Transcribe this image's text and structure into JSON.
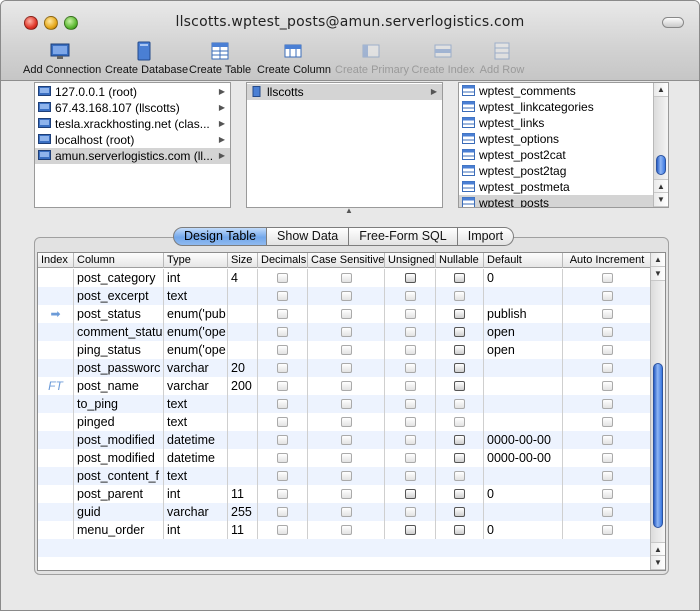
{
  "window": {
    "title": "llscotts.wptest_posts@amun.serverlogistics.com"
  },
  "toolbar": {
    "add_connection": "Add Connection",
    "create_database": "Create Database",
    "create_table": "Create Table",
    "create_column": "Create Column",
    "create_primary": "Create Primary",
    "create_index": "Create Index",
    "add_row": "Add Row"
  },
  "hosts": [
    "127.0.0.1 (root)",
    "67.43.168.107 (llscotts)",
    "tesla.xrackhosting.net (clas...",
    "localhost (root)",
    "amun.serverlogistics.com (ll..."
  ],
  "databases": [
    "llscotts"
  ],
  "tables": [
    "wptest_comments",
    "wptest_linkcategories",
    "wptest_links",
    "wptest_options",
    "wptest_post2cat",
    "wptest_post2tag",
    "wptest_postmeta",
    "wptest_posts"
  ],
  "tabs": {
    "design_table": "Design Table",
    "show_data": "Show Data",
    "free_form_sql": "Free-Form SQL",
    "import": "Import"
  },
  "grid": {
    "headers": {
      "index": "Index",
      "column": "Column",
      "type": "Type",
      "size": "Size",
      "decimals": "Decimals",
      "case_sensitive": "Case Sensitive",
      "unsigned": "Unsigned",
      "nullable": "Nullable",
      "default": "Default",
      "auto_increment": "Auto Increment"
    },
    "rows": [
      {
        "index": "",
        "column": "post_category",
        "type": "int",
        "size": "4",
        "default": "0",
        "unsigned": "dark",
        "nullable": "dark"
      },
      {
        "index": "",
        "column": "post_excerpt",
        "type": "text",
        "size": "",
        "default": "",
        "unsigned": "light",
        "nullable": "light"
      },
      {
        "index": "➡",
        "column": "post_status",
        "type": "enum('pub",
        "size": "",
        "default": "publish",
        "unsigned": "light",
        "nullable": "dark"
      },
      {
        "index": "",
        "column": "comment_statu",
        "type": "enum('ope",
        "size": "",
        "default": "open",
        "unsigned": "light",
        "nullable": "dark"
      },
      {
        "index": "",
        "column": "ping_status",
        "type": "enum('ope",
        "size": "",
        "default": "open",
        "unsigned": "light",
        "nullable": "dark"
      },
      {
        "index": "",
        "column": "post_passworc",
        "type": "varchar",
        "size": "20",
        "default": "",
        "unsigned": "light",
        "nullable": "dark"
      },
      {
        "index": "FT",
        "column": "post_name",
        "type": "varchar",
        "size": "200",
        "default": "",
        "unsigned": "light",
        "nullable": "dark"
      },
      {
        "index": "",
        "column": "to_ping",
        "type": "text",
        "size": "",
        "default": "",
        "unsigned": "light",
        "nullable": "light"
      },
      {
        "index": "",
        "column": "pinged",
        "type": "text",
        "size": "",
        "default": "",
        "unsigned": "light",
        "nullable": "light"
      },
      {
        "index": "",
        "column": "post_modified",
        "type": "datetime",
        "size": "",
        "default": "0000-00-00",
        "unsigned": "light",
        "nullable": "dark"
      },
      {
        "index": "",
        "column": "post_modified",
        "type": "datetime",
        "size": "",
        "default": "0000-00-00",
        "unsigned": "light",
        "nullable": "dark"
      },
      {
        "index": "",
        "column": "post_content_f",
        "type": "text",
        "size": "",
        "default": "",
        "unsigned": "light",
        "nullable": "light"
      },
      {
        "index": "",
        "column": "post_parent",
        "type": "int",
        "size": "11",
        "default": "0",
        "unsigned": "dark",
        "nullable": "dark"
      },
      {
        "index": "",
        "column": "guid",
        "type": "varchar",
        "size": "255",
        "default": "",
        "unsigned": "light",
        "nullable": "dark"
      },
      {
        "index": "",
        "column": "menu_order",
        "type": "int",
        "size": "11",
        "default": "0",
        "unsigned": "dark",
        "nullable": "dark"
      }
    ]
  }
}
